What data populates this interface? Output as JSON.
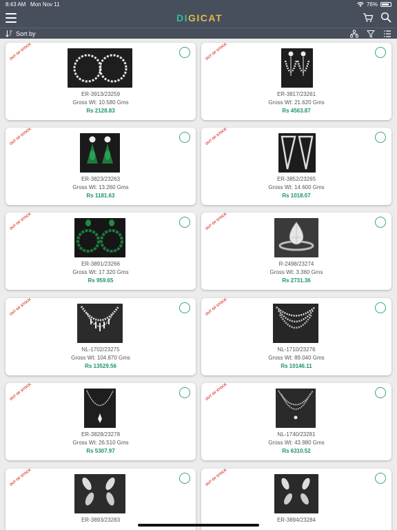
{
  "status": {
    "time": "8:43 AM",
    "date": "Mon Nov 11",
    "battery": "76%"
  },
  "header": {
    "logo_prefix": "DI",
    "logo_suffix": "GICAT"
  },
  "sort_bar": {
    "sort_label": "Sort by"
  },
  "colors": {
    "header_bg": "#474f5d",
    "accent": "#3aa383",
    "price": "#1f8f73",
    "badge": "#d9342b"
  },
  "products": [
    {
      "badge": "OUT OF STOCK",
      "code": "ER-3913/23259",
      "weight": "Gross Wt: 10.580 Gms",
      "price": "Rs 2128.83",
      "image": "hoop-earrings"
    },
    {
      "badge": "OUT OF STOCK",
      "code": "ER-3817/23261",
      "weight": "Gross Wt: 21.620 Gms",
      "price": "Rs 4563.87",
      "image": "chandelier-earrings"
    },
    {
      "badge": "OUT OF STOCK",
      "code": "ER-3823/23263",
      "weight": "Gross Wt: 13.260 Gms",
      "price": "Rs 1181.63",
      "image": "emerald-drop-earrings"
    },
    {
      "badge": "OUT OF STOCK",
      "code": "ER-3852/23265",
      "weight": "Gross Wt: 14.600 Gms",
      "price": "Rs 1018.07",
      "image": "triangle-earrings"
    },
    {
      "badge": "OUT OF STOCK",
      "code": "ER-3891/23266",
      "weight": "Gross Wt: 17.320 Gms",
      "price": "Rs 959.65",
      "image": "emerald-hoop-earrings"
    },
    {
      "badge": "OUT OF STOCK",
      "code": "R-2498/23274",
      "weight": "Gross Wt: 3.360 Gms",
      "price": "Rs 2731.36",
      "image": "pear-ring"
    },
    {
      "badge": "OUT OF STOCK",
      "code": "NL-1702/23275",
      "weight": "Gross Wt: 104.870 Gms",
      "price": "Rs 13529.56",
      "image": "diamond-necklace"
    },
    {
      "badge": "OUT OF STOCK",
      "code": "NL-1710/23276",
      "weight": "Gross Wt: 89.040 Gms",
      "price": "Rs 10146.11",
      "image": "layered-necklace"
    },
    {
      "badge": "OUT OF STOCK",
      "code": "ER-3828/23278",
      "weight": "Gross Wt: 26.510 Gms",
      "price": "Rs 5307.97",
      "image": "pendant-necklace"
    },
    {
      "badge": "OUT OF STOCK",
      "code": "NL-1740/23281",
      "weight": "Gross Wt: 43.980 Gms",
      "price": "Rs 6310.52",
      "image": "double-strand-necklace"
    },
    {
      "badge": "OUT OF STOCK",
      "code": "ER-3893/23283",
      "weight": "",
      "price": "",
      "image": "leaf-earrings"
    },
    {
      "badge": "OUT OF STOCK",
      "code": "ER-3894/23284",
      "weight": "",
      "price": "",
      "image": "leaf-cluster-earrings"
    }
  ]
}
